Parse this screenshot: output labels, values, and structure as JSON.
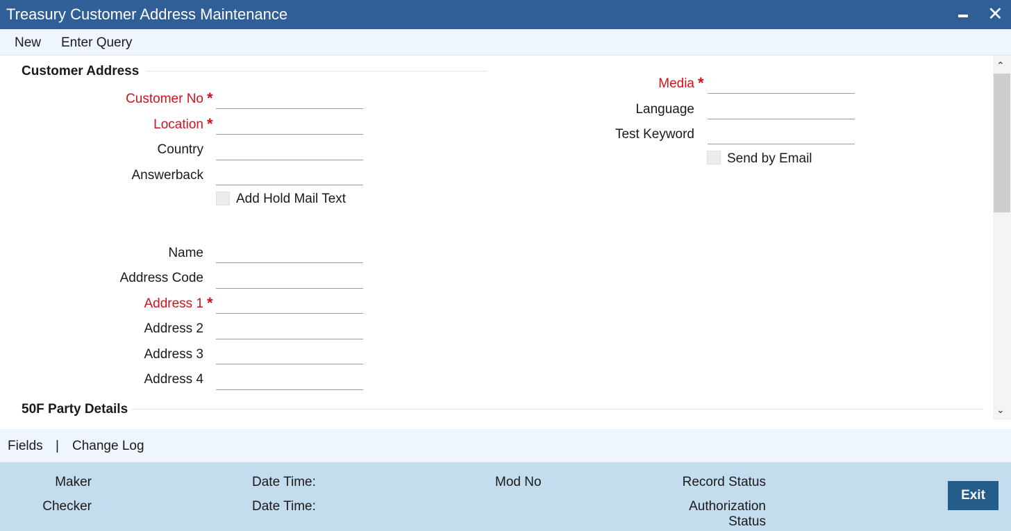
{
  "window": {
    "title": "Treasury Customer Address Maintenance",
    "minimize_icon": "minimize-icon",
    "close_icon": "close-icon",
    "close_glyph": "✕"
  },
  "menu": {
    "new": "New",
    "enter_query": "Enter Query"
  },
  "customer_address": {
    "section_title": "Customer Address",
    "customer_no": {
      "label": "Customer No",
      "value": "",
      "required": true
    },
    "location": {
      "label": "Location",
      "value": "",
      "required": true
    },
    "country": {
      "label": "Country",
      "value": ""
    },
    "answerback": {
      "label": "Answerback",
      "value": ""
    },
    "add_hold_mail_text": {
      "label": "Add Hold Mail Text",
      "checked": false
    },
    "media": {
      "label": "Media",
      "value": "",
      "required": true
    },
    "language": {
      "label": "Language",
      "value": ""
    },
    "test_keyword": {
      "label": "Test Keyword",
      "value": ""
    },
    "send_by_email": {
      "label": "Send by Email",
      "checked": false
    },
    "name": {
      "label": "Name",
      "value": ""
    },
    "address_code": {
      "label": "Address Code",
      "value": ""
    },
    "address_1": {
      "label": "Address 1",
      "value": "",
      "required": true
    },
    "address_2": {
      "label": "Address 2",
      "value": ""
    },
    "address_3": {
      "label": "Address 3",
      "value": ""
    },
    "address_4": {
      "label": "Address 4",
      "value": ""
    },
    "required_marker": "*"
  },
  "party_details": {
    "section_title": "50F Party Details"
  },
  "scrollbar": {
    "up_glyph": "⌃",
    "down_glyph": "⌄"
  },
  "links": {
    "fields": "Fields",
    "separator": "|",
    "change_log": "Change Log"
  },
  "footer": {
    "maker": "Maker",
    "checker": "Checker",
    "date_time_1": "Date Time:",
    "date_time_2": "Date Time:",
    "mod_no": "Mod No",
    "record_status": "Record Status",
    "authorization": "Authorization",
    "status": "Status",
    "exit": "Exit"
  },
  "colors": {
    "titlebar": "#2f5f96",
    "required": "#d0121b",
    "footer": "#c3dcee",
    "exit_button": "#245c8a"
  }
}
